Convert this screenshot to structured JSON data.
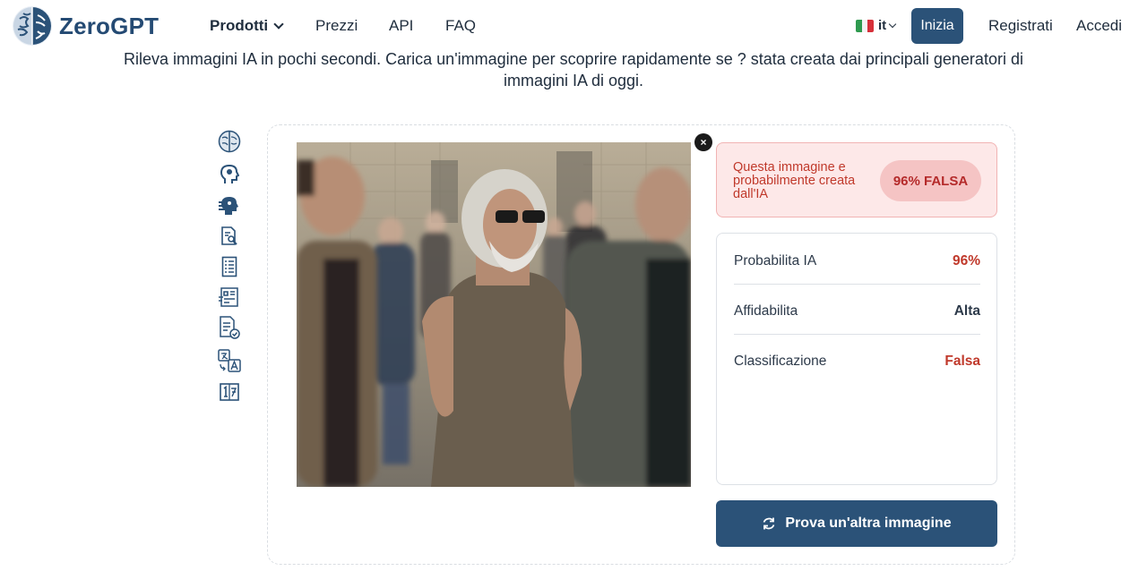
{
  "header": {
    "logo_text": "ZeroGPT",
    "nav": {
      "products": "Prodotti",
      "prices": "Prezzi",
      "api": "API",
      "faq": "FAQ"
    },
    "language": "it",
    "start_button": "Inizia",
    "register": "Registrati",
    "login": "Accedi"
  },
  "subtitle": "Rileva immagini IA in pochi secondi. Carica un'immagine per scoprire rapidamente se ? stata creata dai principali generatori di immagini IA di oggi.",
  "sidebar": {
    "icons": [
      "brain-icon",
      "head-profile-icon",
      "ai-head-icon",
      "document-search-icon",
      "document-list-icon",
      "document-grid-icon",
      "document-check-icon",
      "translate-icon",
      "word-count-icon"
    ]
  },
  "result": {
    "verdict_text": "Questa immagine e probabilmente creata dall'IA",
    "verdict_badge": "96% FALSA",
    "rows": [
      {
        "label": "Probabilita IA",
        "value": "96%"
      },
      {
        "label": "Affidabilita",
        "value": "Alta"
      },
      {
        "label": "Classificazione",
        "value": "Falsa"
      }
    ],
    "retry_button": "Prova un'altra immagine"
  },
  "colors": {
    "brand": "#2b5278",
    "logo_text": "#244a73",
    "alert_red": "#c0392b",
    "alert_bg": "#fde8e8"
  }
}
